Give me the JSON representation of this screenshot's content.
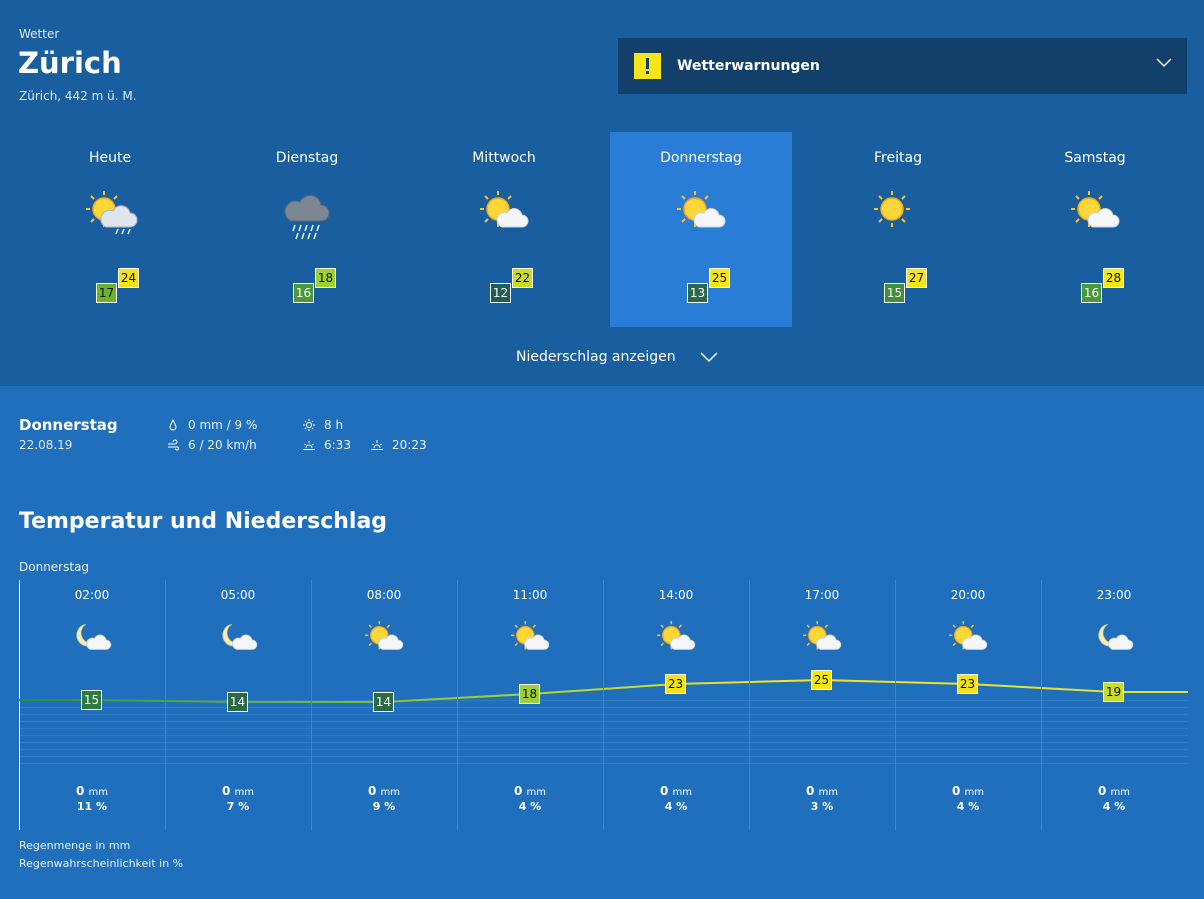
{
  "header": {
    "app_label": "Wetter",
    "city": "Zürich",
    "altitude": "Zürich, 442 m ü. M."
  },
  "warnings": {
    "label": "Wetterwarnungen",
    "accent": "#f6e619"
  },
  "days": [
    {
      "name": "Heute",
      "min": "17",
      "max": "24",
      "icon": "sun-cloud-rain-icon",
      "min_color": "#6ab42a",
      "max_color": "#f3e21a",
      "selected": false
    },
    {
      "name": "Dienstag",
      "min": "16",
      "max": "18",
      "icon": "rain-cloud-icon",
      "min_color": "#4a9a3a",
      "max_color": "#9ed036",
      "selected": false
    },
    {
      "name": "Mittwoch",
      "min": "12",
      "max": "22",
      "icon": "sun-cloud-icon",
      "min_color": "#1e5f52",
      "max_color": "#c8dc28",
      "selected": false
    },
    {
      "name": "Donnerstag",
      "min": "13",
      "max": "25",
      "icon": "sun-cloud-icon",
      "min_color": "#2a6a44",
      "max_color": "#f6e619",
      "selected": true
    },
    {
      "name": "Freitag",
      "min": "15",
      "max": "27",
      "icon": "sun-icon",
      "min_color": "#3f8f3c",
      "max_color": "#f6e619",
      "selected": false
    },
    {
      "name": "Samstag",
      "min": "16",
      "max": "28",
      "icon": "sun-cloud-icon",
      "min_color": "#4a9a3a",
      "max_color": "#f6e619",
      "selected": false
    }
  ],
  "precip_toggle": "Niederschlag anzeigen",
  "detail": {
    "day": "Donnerstag",
    "date": "22.08.19",
    "precip": "0 mm / 9 %",
    "wind": "6 / 20 km/h",
    "sunshine": "8 h",
    "sunrise": "6:33",
    "sunset": "20:23"
  },
  "section_title": "Temperatur und Niederschlag",
  "hourly_day": "Donnerstag",
  "hourly": [
    {
      "time": "02:00",
      "icon": "moon-cloud-icon",
      "temp": 15,
      "color": "#2f7a3f",
      "rain": "0",
      "unit": "mm",
      "pct": "11 %"
    },
    {
      "time": "05:00",
      "icon": "moon-cloud-icon",
      "temp": 14,
      "color": "#2a6a44",
      "rain": "0",
      "unit": "mm",
      "pct": "7 %"
    },
    {
      "time": "08:00",
      "icon": "sun-cloud-icon",
      "temp": 14,
      "color": "#2a6a44",
      "rain": "0",
      "unit": "mm",
      "pct": "9 %"
    },
    {
      "time": "11:00",
      "icon": "sun-cloud-icon",
      "temp": 18,
      "color": "#9ed036",
      "rain": "0",
      "unit": "mm",
      "pct": "4 %"
    },
    {
      "time": "14:00",
      "icon": "sun-cloud-icon",
      "temp": 23,
      "color": "#f3e21a",
      "rain": "0",
      "unit": "mm",
      "pct": "4 %"
    },
    {
      "time": "17:00",
      "icon": "sun-cloud-icon",
      "temp": 25,
      "color": "#f6e619",
      "rain": "0",
      "unit": "mm",
      "pct": "3 %"
    },
    {
      "time": "20:00",
      "icon": "sun-cloud-icon",
      "temp": 23,
      "color": "#f3e21a",
      "rain": "0",
      "unit": "mm",
      "pct": "4 %"
    },
    {
      "time": "23:00",
      "icon": "moon-cloud-icon",
      "temp": 19,
      "color": "#c8dc28",
      "rain": "0",
      "unit": "mm",
      "pct": "4 %"
    }
  ],
  "legend": {
    "rain_amount": "Regenmenge in mm",
    "rain_probability": "Regenwahrscheinlichkeit in %"
  }
}
